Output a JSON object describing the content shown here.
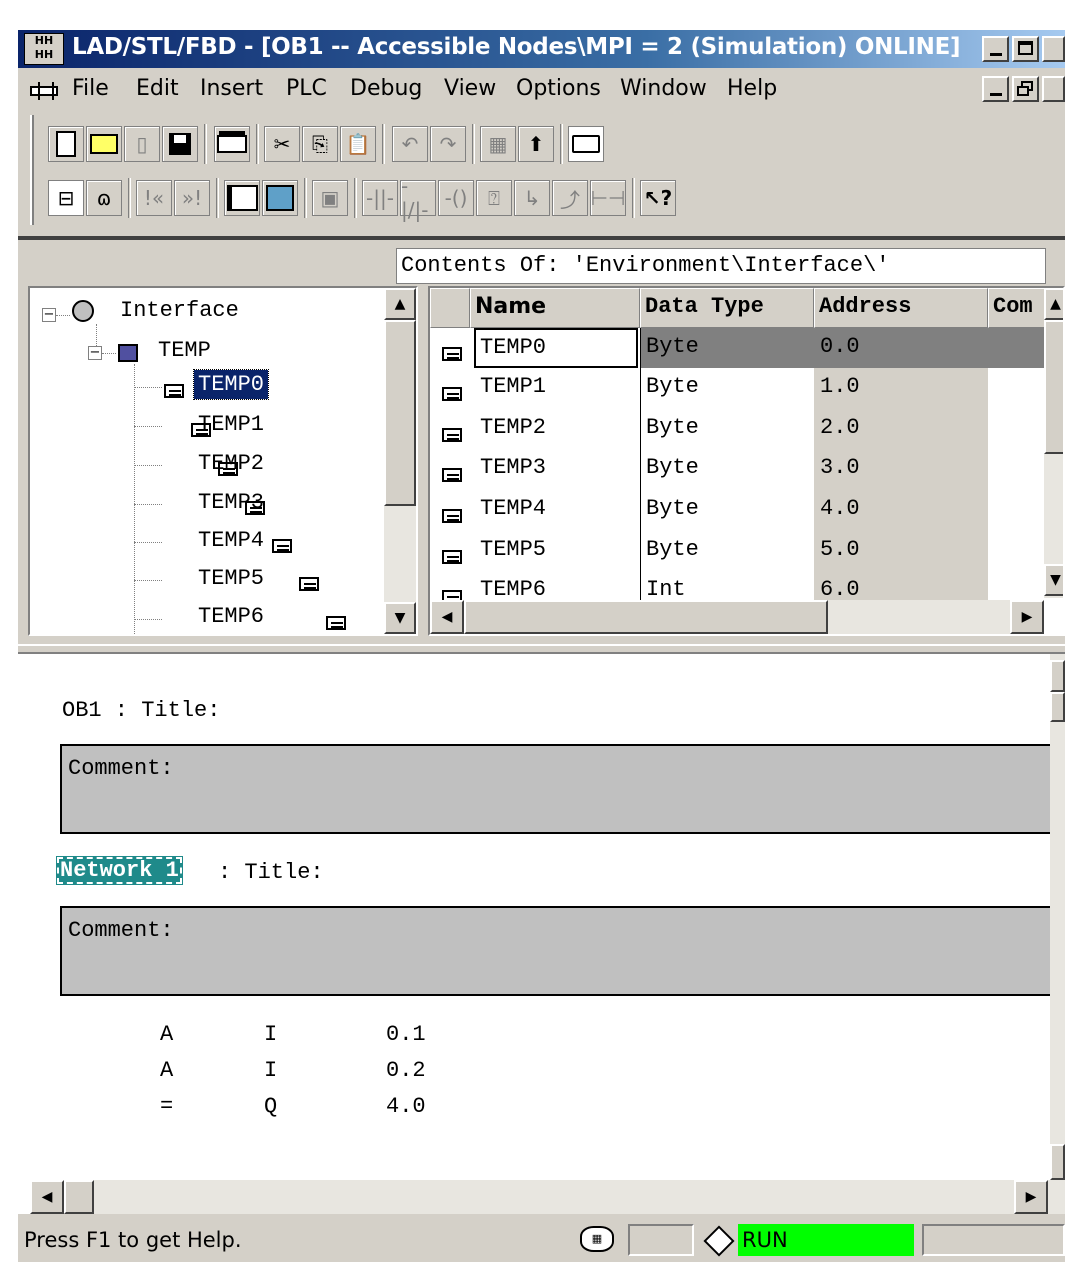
{
  "window": {
    "title": "LAD/STL/FBD  - [OB1 -- Accessible Nodes\\MPI =  2 (Simulation) ONLINE]"
  },
  "menu": [
    "File",
    "Edit",
    "Insert",
    "PLC",
    "Debug",
    "View",
    "Options",
    "Window",
    "Help"
  ],
  "contents_header": "Contents Of:  'Environment\\Interface\\'",
  "tree": {
    "root": "Interface",
    "group": "TEMP",
    "items": [
      "TEMP0",
      "TEMP1",
      "TEMP2",
      "TEMP3",
      "TEMP4",
      "TEMP5",
      "TEMP6"
    ],
    "selected": "TEMP0"
  },
  "table": {
    "columns": [
      "Name",
      "Data Type",
      "Address",
      "Com"
    ],
    "rows": [
      {
        "name": "TEMP0",
        "type": "Byte",
        "address": "0.0"
      },
      {
        "name": "TEMP1",
        "type": "Byte",
        "address": "1.0"
      },
      {
        "name": "TEMP2",
        "type": "Byte",
        "address": "2.0"
      },
      {
        "name": "TEMP3",
        "type": "Byte",
        "address": "3.0"
      },
      {
        "name": "TEMP4",
        "type": "Byte",
        "address": "4.0"
      },
      {
        "name": "TEMP5",
        "type": "Byte",
        "address": "5.0"
      },
      {
        "name": "TEMP6",
        "type": "Int",
        "address": "6.0"
      }
    ]
  },
  "editor": {
    "block_title": "OB1 : Title:",
    "block_comment": "Comment:",
    "network_label": "Network 1",
    "network_title": ": Title:",
    "network_comment": "Comment:",
    "code": [
      {
        "op": "A",
        "operand": "I",
        "address": "0.1"
      },
      {
        "op": "A",
        "operand": "I",
        "address": "0.2"
      },
      {
        "op": "=",
        "operand": "Q",
        "address": "4.0"
      }
    ]
  },
  "status": {
    "help": "Press F1 to get Help.",
    "mode": "RUN",
    "mode_color": "#00ff00"
  }
}
